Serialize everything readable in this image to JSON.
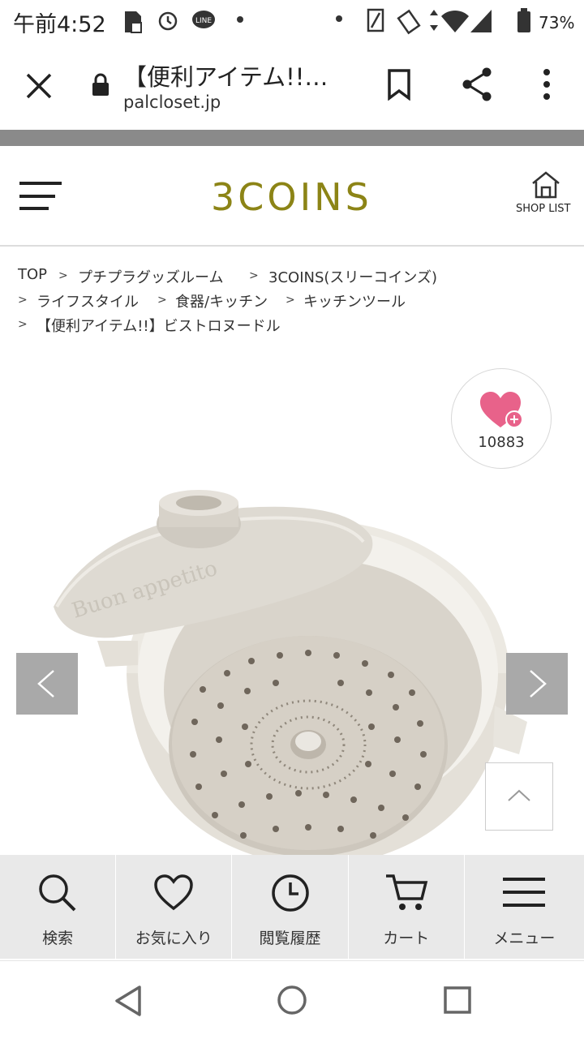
{
  "status_bar": {
    "time": "午前4:52",
    "battery": "73%",
    "icons": [
      "sd-card-icon",
      "alarm-icon",
      "line-icon",
      "dot-icon",
      "nfc-icon",
      "vibrate-icon",
      "data-arrows-icon",
      "wifi-icon",
      "signal-icon",
      "battery-icon"
    ]
  },
  "browser": {
    "close_icon": "close-icon",
    "lock_icon": "lock-icon",
    "title": "【便利アイテム!!…",
    "url": "palcloset.jp",
    "bookmark_icon": "bookmark-icon",
    "share_icon": "share-icon",
    "more_icon": "more-vertical-icon"
  },
  "site_header": {
    "menu_icon": "hamburger-icon",
    "logo": "3COINS",
    "logo_color": "#8c8416",
    "shop_list_label": "SHOP LIST"
  },
  "breadcrumb": {
    "separator": ">",
    "items": [
      "TOP",
      "プチプラグッズルーム",
      "3COINS(スリーコインズ)",
      "ライフスタイル",
      "食器/キッチン",
      "キッチンツール",
      "【便利アイテム!!】ビストロヌードル"
    ]
  },
  "product": {
    "favorite_count": "10883",
    "heart_color": "#e8628a",
    "lid_text": "Buon appetito"
  },
  "bottom_nav": {
    "items": [
      {
        "label": "検索",
        "icon": "search-icon"
      },
      {
        "label": "お気に入り",
        "icon": "heart-icon"
      },
      {
        "label": "閲覧履歴",
        "icon": "clock-icon"
      },
      {
        "label": "カート",
        "icon": "cart-icon"
      },
      {
        "label": "メニュー",
        "icon": "menu-icon"
      }
    ]
  },
  "system_nav": {
    "icons": [
      "back-icon",
      "home-icon",
      "recents-icon"
    ]
  }
}
